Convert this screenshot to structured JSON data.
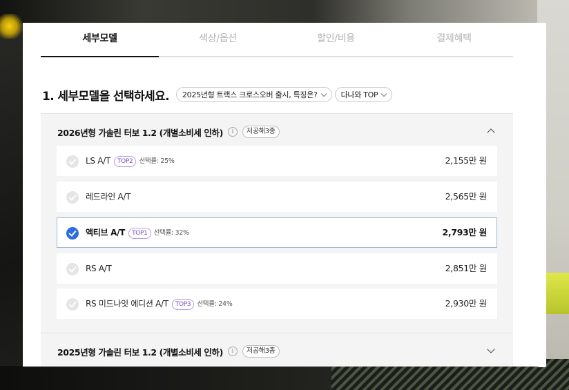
{
  "tabs": [
    {
      "label": "세부모델",
      "active": true
    },
    {
      "label": "색상/옵션",
      "active": false
    },
    {
      "label": "할인/비용",
      "active": false
    },
    {
      "label": "결제혜택",
      "active": false
    }
  ],
  "section": {
    "heading": "1. 세부모델을 선택하세요.",
    "chips": [
      {
        "label": "2025년형 트랙스 크로스오버 출시, 특징은?"
      },
      {
        "label": "다나와 TOP"
      }
    ]
  },
  "groups": [
    {
      "title": "2026년형 가솔린 터보 1.2 (개별소비세 인하)",
      "info_icon": "i",
      "tag": "저공해3종",
      "expanded": true,
      "rows": [
        {
          "name": "LS A/T",
          "badge": "TOP2",
          "rate": "선택률: 25%",
          "price": "2,155만 원",
          "selected": false
        },
        {
          "name": "레드라인 A/T",
          "badge": "",
          "rate": "",
          "price": "2,565만 원",
          "selected": false
        },
        {
          "name": "액티브 A/T",
          "badge": "TOP1",
          "rate": "선택률: 32%",
          "price": "2,793만 원",
          "selected": true
        },
        {
          "name": "RS A/T",
          "badge": "",
          "rate": "",
          "price": "2,851만 원",
          "selected": false
        },
        {
          "name": "RS 미드나잇 에디션 A/T",
          "badge": "TOP3",
          "rate": "선택률: 24%",
          "price": "2,930만 원",
          "selected": false
        }
      ]
    },
    {
      "title": "2025년형 가솔린 터보 1.2 (개별소비세 인하)",
      "info_icon": "i",
      "tag": "저공해3종",
      "expanded": false,
      "rows": []
    }
  ],
  "colors": {
    "accent": "#2e6ce0",
    "top_badge": "#7b4fc7",
    "selected_border": "#9cb6dd"
  }
}
